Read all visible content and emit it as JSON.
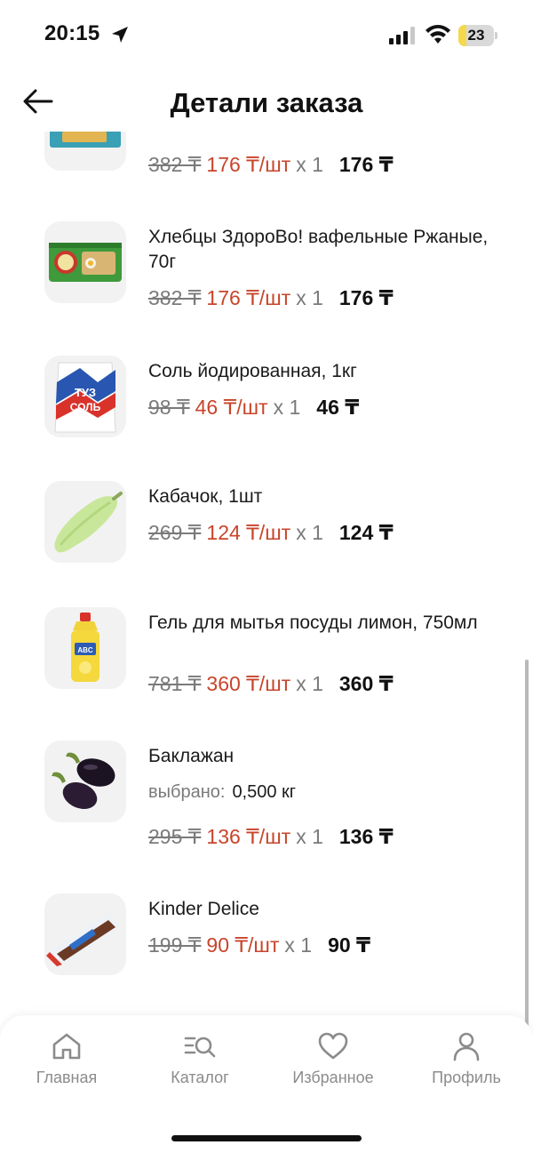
{
  "status_bar": {
    "time": "20:15",
    "battery": "23",
    "battery_level": 0.23,
    "battery_color": "#f5d94a"
  },
  "header": {
    "title": "Детали заказа",
    "back_icon": "arrow-left-icon"
  },
  "order_items": [
    {
      "name": "",
      "old_price": "382 ₸",
      "new_price": "176 ₸/шт",
      "qty": "x 1",
      "total": "176 ₸"
    },
    {
      "name": "Хлебцы ЗдороВо! вафельные Ржаные, 70г",
      "old_price": "382 ₸",
      "new_price": "176 ₸/шт",
      "qty": "x 1",
      "total": "176 ₸"
    },
    {
      "name": "Соль йодированная, 1кг",
      "old_price": "98 ₸",
      "new_price": "46 ₸/шт",
      "qty": "x 1",
      "total": "46 ₸"
    },
    {
      "name": "Кабачок, 1шт",
      "old_price": "269 ₸",
      "new_price": "124 ₸/шт",
      "qty": "x 1",
      "total": "124 ₸"
    },
    {
      "name": "Гель для мытья посуды лимон, 750мл",
      "old_price": "781 ₸",
      "new_price": "360 ₸/шт",
      "qty": "x 1",
      "total": "360 ₸"
    },
    {
      "name": "Баклажан",
      "selected_label": "выбрано:",
      "selected_value": "0,500 кг",
      "old_price": "295 ₸",
      "new_price": "136 ₸/шт",
      "qty": "x 1",
      "total": "136 ₸"
    },
    {
      "name": "Kinder Delice",
      "old_price": "199 ₸",
      "new_price": "90 ₸/шт",
      "qty": "x 1",
      "total": "90 ₸"
    }
  ],
  "bottom_nav": [
    {
      "label": "Главная",
      "icon": "home-icon"
    },
    {
      "label": "Каталог",
      "icon": "catalog-search-icon"
    },
    {
      "label": "Избранное",
      "icon": "heart-icon"
    },
    {
      "label": "Профиль",
      "icon": "profile-icon"
    }
  ],
  "colors": {
    "discount_price": "#c8452b",
    "muted_text": "#7a7a7a",
    "nav_inactive": "#8b8b8b"
  }
}
